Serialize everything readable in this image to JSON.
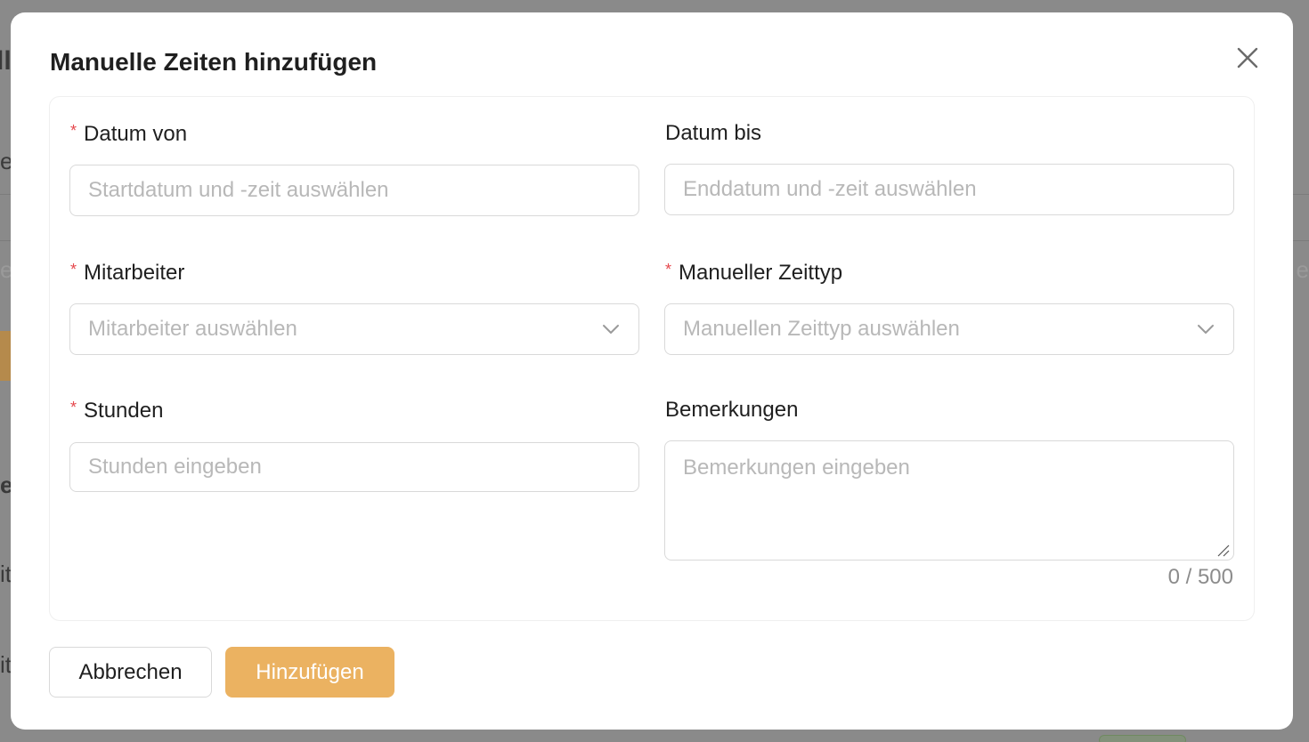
{
  "modal": {
    "title": "Manuelle Zeiten hinzufügen",
    "close_icon": "close-icon"
  },
  "form": {
    "required_marker": "*",
    "date_from": {
      "label": "Datum von",
      "required": true,
      "placeholder": "Startdatum und -zeit auswählen",
      "value": ""
    },
    "date_to": {
      "label": "Datum bis",
      "required": false,
      "placeholder": "Enddatum und -zeit auswählen",
      "value": ""
    },
    "employee": {
      "label": "Mitarbeiter",
      "required": true,
      "placeholder": "Mitarbeiter auswählen",
      "icon": "chevron-down-icon"
    },
    "time_type": {
      "label": "Manueller Zeittyp",
      "required": true,
      "placeholder": "Manuellen Zeittyp auswählen",
      "icon": "chevron-down-icon"
    },
    "hours": {
      "label": "Stunden",
      "required": true,
      "placeholder": "Stunden eingeben",
      "value": ""
    },
    "remarks": {
      "label": "Bemerkungen",
      "required": false,
      "placeholder": "Bemerkungen eingeben",
      "value": "",
      "counter": "0 / 500"
    }
  },
  "footer": {
    "cancel_label": "Abbrechen",
    "submit_label": "Hinzufügen"
  },
  "colors": {
    "primary": "#ebb261",
    "required": "#e5484d",
    "overlay": "#8a8a8a"
  },
  "background": {
    "fragments": [
      "ll",
      "e",
      "e",
      "ei",
      "it",
      "it",
      "e"
    ]
  }
}
